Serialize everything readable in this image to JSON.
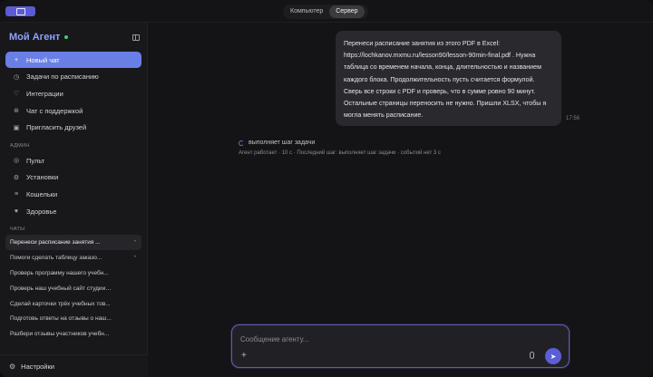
{
  "topbar": {
    "tabs": [
      {
        "label": "Компьютер",
        "active": false
      },
      {
        "label": "Сервер",
        "active": true
      }
    ]
  },
  "sidebar": {
    "brand": "Мой Агент",
    "nav": [
      {
        "label": "Новый чат",
        "icon": "plus-icon"
      },
      {
        "label": "Задачи по расписанию",
        "icon": "clock-icon"
      },
      {
        "label": "Интеграции",
        "icon": "plug-icon"
      },
      {
        "label": "Чат с поддержкой",
        "icon": "headset-icon"
      },
      {
        "label": "Пригласить друзей",
        "icon": "gift-icon"
      }
    ],
    "admin_label": "АДМИН",
    "admin": [
      {
        "label": "Пульт",
        "icon": "dashboard-icon"
      },
      {
        "label": "Установки",
        "icon": "settings-icon"
      },
      {
        "label": "Кошельки",
        "icon": "wallet-icon"
      },
      {
        "label": "Здоровье",
        "icon": "health-icon"
      }
    ],
    "chats_label": "ЧАТЫ",
    "chats": [
      "Перенеси расписание занятия ...",
      "Помоги сделать таблицу заказо...",
      "Проверь программу нашего учебн...",
      "Проверь наш учебный сайт студии ...",
      "Сделай карточки трёх учебных тов...",
      "Подготовь ответы на отзывы о наш...",
      "Разбери отзывы участников учебн..."
    ],
    "settings_label": "Настройки"
  },
  "main": {
    "user_message": "Перенеси расписание занятия из этого PDF в Excel: https://lochkanov.mxmu.ru/lesson90/lesson-90min-final.pdf . Нужна таблица со временем начала, конца, длительностью и названием каждого блока. Продолжительность пусть считается формулой. Сверь все строки с PDF и проверь, что в сумме ровно 90 минут. Остальные страницы переносить не нужно. Пришли XLSX, чтобы я могла менять расписание.",
    "message_time": "17:56",
    "status_title": "выполняет шаг задачи",
    "status_meta": "Агент работает · 10 с · Последний шаг: выполняет шаг задачи · событий нет 3 с",
    "composer_placeholder": "Сообщение агенту..."
  },
  "colors": {
    "accent": "#6a7fe6",
    "brand": "#8fa2ff",
    "online": "#3ecf6e",
    "send": "#5b5fd6"
  }
}
